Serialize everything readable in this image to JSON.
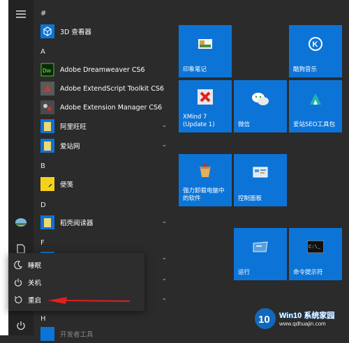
{
  "list": {
    "headers": [
      "#",
      "A",
      "B",
      "D",
      "F",
      "H"
    ],
    "items": [
      {
        "label": "3D 查看器"
      },
      {
        "label": "Adobe Dreamweaver CS6"
      },
      {
        "label": "Adobe ExtendScript Toolkit CS6"
      },
      {
        "label": "Adobe Extension Manager CS6"
      },
      {
        "label": "阿里旺旺"
      },
      {
        "label": "爱站网"
      },
      {
        "label": "便笺"
      },
      {
        "label": "稻壳阅读器"
      },
      {
        "label": "开发者工具"
      }
    ]
  },
  "tiles": [
    {
      "label": "印象笔记"
    },
    {
      "label": "酷狗音乐"
    },
    {
      "label": "XMind 7\n(Update 1)"
    },
    {
      "label": "微信"
    },
    {
      "label": "爱站SEO工具包"
    },
    {
      "label": "强力卸载电脑中\n的软件"
    },
    {
      "label": "控制面板"
    },
    {
      "label": "运行"
    },
    {
      "label": "命令提示符"
    }
  ],
  "power_menu": {
    "sleep": "睡眠",
    "shutdown": "关机",
    "restart": "重启"
  },
  "watermark": {
    "brand": "Win10 系统家园",
    "url": "www.qdhuajin.com"
  },
  "colors": {
    "tile": "#0d74d7",
    "arrow": "#e02020"
  }
}
